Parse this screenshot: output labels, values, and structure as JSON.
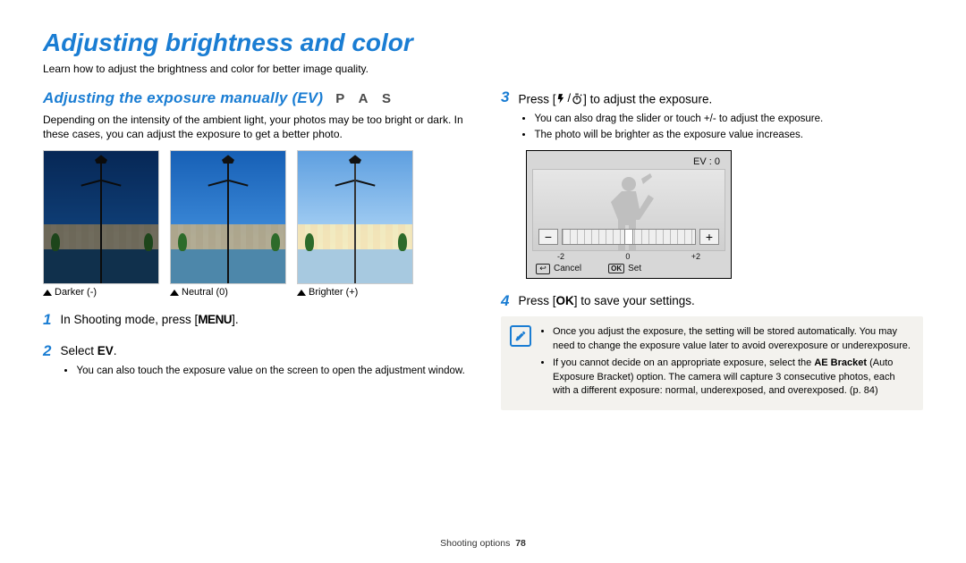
{
  "page": {
    "title": "Adjusting brightness and color",
    "intro": "Learn how to adjust the brightness and color for better image quality.",
    "footer_section": "Shooting options",
    "footer_page": "78"
  },
  "section": {
    "title": "Adjusting the exposure manually (EV)",
    "modes": "P A S",
    "desc": "Depending on the intensity of the ambient light, your photos may be too bright or dark. In these cases, you can adjust the exposure to get a better photo."
  },
  "examples": {
    "darker": "Darker (-)",
    "neutral": "Neutral (0)",
    "brighter": "Brighter (+)"
  },
  "left_steps": {
    "s1_num": "1",
    "s1_text_a": "In Shooting mode, press [",
    "s1_menu": "MENU",
    "s1_text_b": "].",
    "s2_num": "2",
    "s2_text_a": "Select ",
    "s2_bold": "EV",
    "s2_text_b": ".",
    "s2_bullet": "You can also touch the exposure value on the screen to open the adjustment window."
  },
  "right_steps": {
    "s3_num": "3",
    "s3_text_a": "Press [",
    "s3_text_b": "] to adjust the exposure.",
    "s3_bullet1": "You can also drag the slider or touch +/- to adjust the exposure.",
    "s3_bullet2": "The photo will be brighter as the exposure value increases.",
    "s4_num": "4",
    "s4_text_a": "Press [",
    "s4_ok": "OK",
    "s4_text_b": "] to save your settings."
  },
  "ev_screen": {
    "header": "EV : 0",
    "minus": "−",
    "plus": "+",
    "scale_left": "-2",
    "scale_mid": "0",
    "scale_right": "+2",
    "cancel": "Cancel",
    "ok": "OK",
    "set": "Set"
  },
  "chart_data": {
    "type": "bar",
    "title": "EV slider",
    "categories": [
      "-2",
      "0",
      "+2"
    ],
    "values": [
      -2,
      0,
      2
    ],
    "xlabel": "",
    "ylabel": "",
    "xlim": [
      -2,
      2
    ],
    "current_value": 0
  },
  "note": {
    "b1_a": "Once you adjust the exposure, the setting will be stored automatically. You may need to change the exposure value later to avoid overexposure or underexposure.",
    "b2_a": "If you cannot decide on an appropriate exposure, select the ",
    "b2_bold": "AE Bracket",
    "b2_b": " (Auto Exposure Bracket) option. The camera will capture 3 consecutive photos, each with a different exposure: normal, underexposed, and overexposed. (p. 84)"
  }
}
